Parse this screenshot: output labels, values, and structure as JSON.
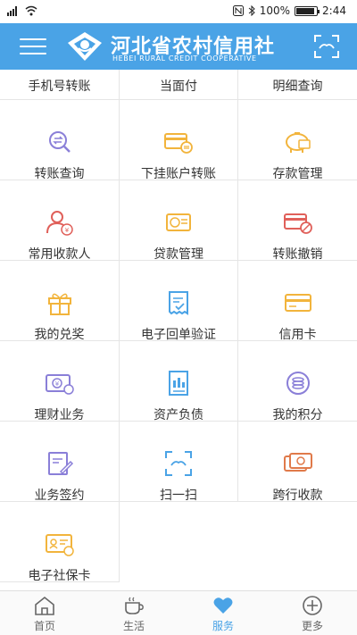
{
  "status_bar": {
    "battery": "100%",
    "time": "2:44"
  },
  "header": {
    "title": "河北省农村信用社",
    "subtitle": "HEBEI RURAL CREDIT COOPERATIVE"
  },
  "top_row": [
    "手机号转账",
    "当面付",
    "明细查询"
  ],
  "services": [
    {
      "label": "转账查询",
      "icon": "transfer-search-icon"
    },
    {
      "label": "下挂账户转账",
      "icon": "linked-card-transfer-icon"
    },
    {
      "label": "存款管理",
      "icon": "piggy-bank-icon"
    },
    {
      "label": "常用收款人",
      "icon": "payee-icon"
    },
    {
      "label": "贷款管理",
      "icon": "loan-card-icon"
    },
    {
      "label": "转账撤销",
      "icon": "cancel-card-icon"
    },
    {
      "label": "我的兑奖",
      "icon": "gift-icon"
    },
    {
      "label": "电子回单验证",
      "icon": "receipt-verify-icon"
    },
    {
      "label": "信用卡",
      "icon": "credit-card-icon"
    },
    {
      "label": "理财业务",
      "icon": "wealth-icon"
    },
    {
      "label": "资产负债",
      "icon": "asset-report-icon"
    },
    {
      "label": "我的积分",
      "icon": "points-coin-icon"
    },
    {
      "label": "业务签约",
      "icon": "sign-contract-icon"
    },
    {
      "label": "扫一扫",
      "icon": "scan-icon"
    },
    {
      "label": "跨行收款",
      "icon": "interbank-collect-icon"
    },
    {
      "label": "电子社保卡",
      "icon": "social-security-card-icon"
    }
  ],
  "tabs": [
    {
      "label": "首页",
      "icon": "home-icon"
    },
    {
      "label": "生活",
      "icon": "coffee-cup-icon"
    },
    {
      "label": "服务",
      "icon": "heart-icon",
      "active": true
    },
    {
      "label": "更多",
      "icon": "plus-circle-icon"
    }
  ],
  "colors": {
    "header": "#4AA3E6",
    "icon_purple": "#8A7FD8",
    "icon_orange": "#F2B43C",
    "icon_red": "#E0605A",
    "icon_blue": "#4AA3E6"
  }
}
